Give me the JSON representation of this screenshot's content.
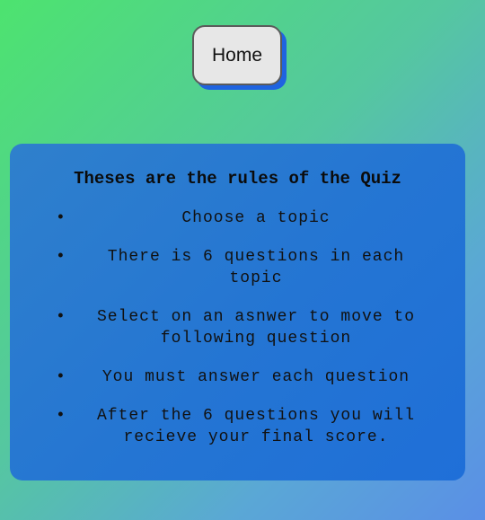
{
  "home_button": {
    "label": "Home"
  },
  "rules": {
    "title": "Theses are the rules of the Quiz",
    "items": [
      "Choose a topic",
      "There is 6 questions in each topic",
      "Select on an asnwer to move to following question",
      "You must answer each question",
      "After the 6 questions you will recieve your final score."
    ]
  },
  "colors": {
    "card": "#2475d3",
    "button_shadow": "#1f63e0",
    "button_bg": "#e7e7e7"
  }
}
